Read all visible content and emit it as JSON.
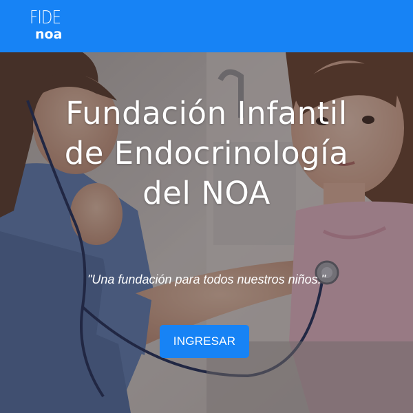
{
  "header": {
    "logo": {
      "line1": "FIDE",
      "line2": "noa"
    },
    "brand_color": "#1783f5"
  },
  "hero": {
    "title": "Fundación Infantil de Endocrinología del NOA",
    "subtitle": "\"Una fundación para todos nuestros niños.\"",
    "cta_label": "INGRESAR",
    "background": "doctor listening to child's heartbeat with stethoscope"
  }
}
